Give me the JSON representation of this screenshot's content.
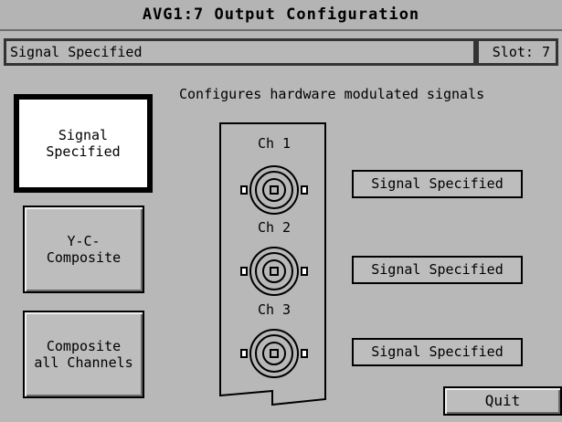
{
  "window": {
    "title": "AVG1:7  Output Configuration"
  },
  "status": {
    "mode": "Signal Specified",
    "slot": "Slot: 7"
  },
  "mode_buttons": [
    {
      "label": "Signal\nSpecified",
      "selected": true
    },
    {
      "label": "Y-C-\nComposite",
      "selected": false
    },
    {
      "label": "Composite\nall Channels",
      "selected": false
    }
  ],
  "description": "Configures hardware modulated signals",
  "channels": [
    {
      "label": "Ch 1",
      "output": "Signal Specified",
      "icon": "bnc-connector-icon"
    },
    {
      "label": "Ch 2",
      "output": "Signal Specified",
      "icon": "bnc-connector-icon"
    },
    {
      "label": "Ch 3",
      "output": "Signal Specified",
      "icon": "bnc-connector-icon"
    }
  ],
  "quit_label": "Quit"
}
